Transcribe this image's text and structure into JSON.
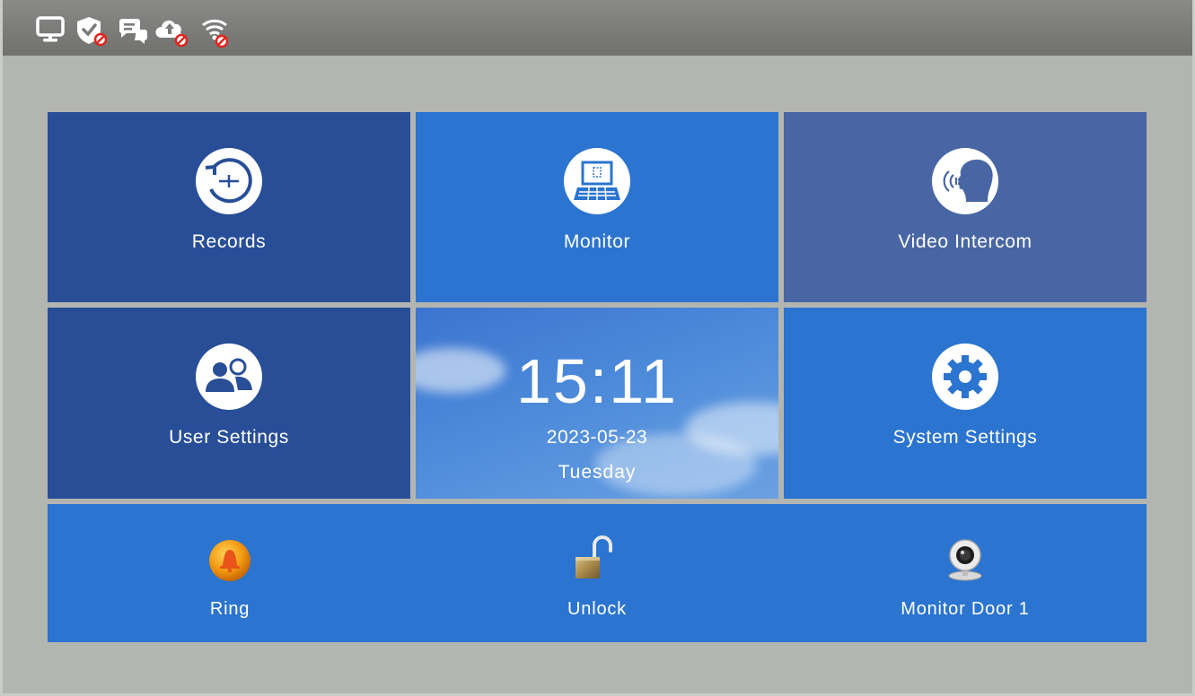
{
  "statusbar": {
    "icons": [
      "monitor-icon",
      "shield-disabled-icon",
      "chat-disabled-icon",
      "cloud-upload-disabled-icon",
      "wifi-disabled-icon"
    ]
  },
  "tiles": {
    "records": {
      "label": "Records",
      "icon": "records-history-icon"
    },
    "monitor": {
      "label": "Monitor",
      "icon": "monitor-keyboard-icon"
    },
    "video_intercom": {
      "label": "Video Intercom",
      "icon": "speaking-head-icon"
    },
    "user_settings": {
      "label": "User Settings",
      "icon": "users-icon"
    },
    "system_settings": {
      "label": "System Settings",
      "icon": "gear-icon"
    }
  },
  "clock": {
    "time": "15:11",
    "date": "2023-05-23",
    "day": "Tuesday"
  },
  "actions": {
    "ring": {
      "label": "Ring",
      "icon": "bell-icon"
    },
    "unlock": {
      "label": "Unlock",
      "icon": "open-padlock-icon"
    },
    "monitor_door": {
      "label": "Monitor Door 1",
      "icon": "webcam-icon"
    }
  },
  "colors": {
    "status_bar": "#7a7a78",
    "background": "#b3b5b1",
    "tile_dark": "#284e98",
    "tile_bright": "#2b74d0",
    "tile_slate": "#4966a4"
  }
}
